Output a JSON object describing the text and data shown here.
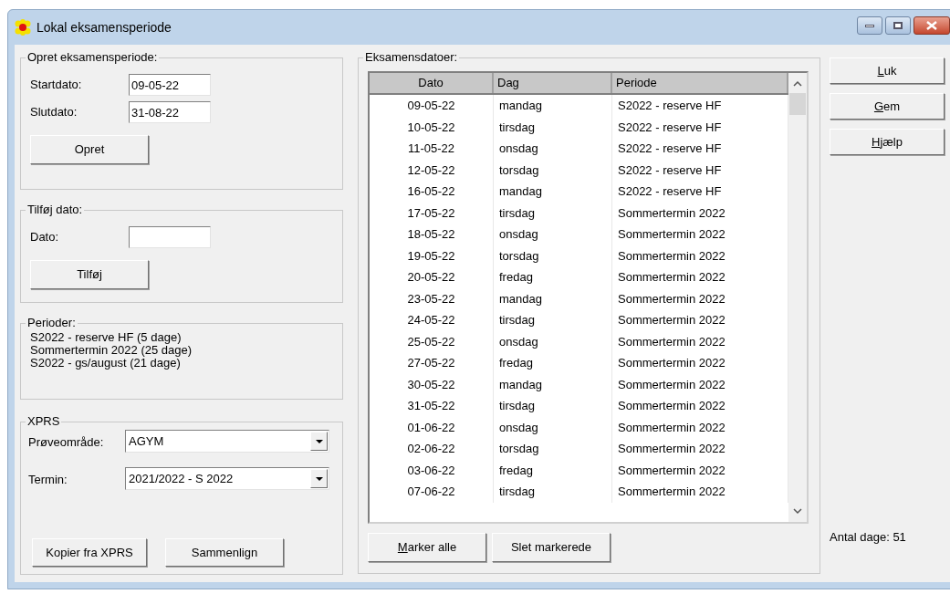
{
  "window": {
    "title": "Lokal eksamensperiode",
    "controls": [
      {
        "kind": "minimize"
      },
      {
        "kind": "maximize"
      },
      {
        "kind": "close"
      }
    ]
  },
  "opret": {
    "title": "Opret eksamensperiode:",
    "fields": [
      {
        "label": "Startdato:",
        "value": "09-05-22"
      },
      {
        "label": "Slutdato:",
        "value": "31-08-22"
      }
    ],
    "button": {
      "label": "Opret",
      "mnemonic": false
    }
  },
  "tilfoej": {
    "title": "Tilføj dato:",
    "fields": [
      {
        "label": "Dato:"
      }
    ],
    "button": {
      "label": "Tilføj",
      "mnemonic": false
    }
  },
  "perioder": {
    "title": "Perioder:",
    "lines": [
      "S2022 - reserve HF (5 dage)",
      "Sommertermin 2022 (25 dage)",
      "S2022 - gs/august (21 dage)"
    ]
  },
  "xprs": {
    "title": "XPRS",
    "combos": [
      {
        "label": "Prøveområde:",
        "value": "AGYM"
      },
      {
        "label": "Termin:",
        "value": "2021/2022 - S 2022"
      }
    ],
    "buttons": [
      {
        "label": "Kopier fra XPRS",
        "mnemonic": false
      },
      {
        "label": "Sammenlign",
        "mnemonic": false
      }
    ]
  },
  "eksamensdatoer": {
    "title": "Eksamensdatoer:",
    "table": {
      "columns": [
        "Dato",
        "Dag",
        "Periode"
      ],
      "rows": [
        [
          "09-05-22",
          "mandag",
          "S2022 - reserve HF"
        ],
        [
          "10-05-22",
          "tirsdag",
          "S2022 - reserve HF"
        ],
        [
          "11-05-22",
          "onsdag",
          "S2022 - reserve HF"
        ],
        [
          "12-05-22",
          "torsdag",
          "S2022 - reserve HF"
        ],
        [
          "16-05-22",
          "mandag",
          "S2022 - reserve HF"
        ],
        [
          "17-05-22",
          "tirsdag",
          "Sommertermin 2022"
        ],
        [
          "18-05-22",
          "onsdag",
          "Sommertermin 2022"
        ],
        [
          "19-05-22",
          "torsdag",
          "Sommertermin 2022"
        ],
        [
          "20-05-22",
          "fredag",
          "Sommertermin 2022"
        ],
        [
          "23-05-22",
          "mandag",
          "Sommertermin 2022"
        ],
        [
          "24-05-22",
          "tirsdag",
          "Sommertermin 2022"
        ],
        [
          "25-05-22",
          "onsdag",
          "Sommertermin 2022"
        ],
        [
          "27-05-22",
          "fredag",
          "Sommertermin 2022"
        ],
        [
          "30-05-22",
          "mandag",
          "Sommertermin 2022"
        ],
        [
          "31-05-22",
          "tirsdag",
          "Sommertermin 2022"
        ],
        [
          "01-06-22",
          "onsdag",
          "Sommertermin 2022"
        ],
        [
          "02-06-22",
          "torsdag",
          "Sommertermin 2022"
        ],
        [
          "03-06-22",
          "fredag",
          "Sommertermin 2022"
        ],
        [
          "07-06-22",
          "tirsdag",
          "Sommertermin 2022"
        ]
      ]
    },
    "buttons": [
      {
        "label": "Marker alle",
        "mnemonic": true
      },
      {
        "label": "Slet markerede",
        "mnemonic": false
      }
    ]
  },
  "side_buttons": [
    {
      "label": "Luk",
      "mnemonic": true
    },
    {
      "label": "Gem",
      "mnemonic": true
    },
    {
      "label": "Hjælp",
      "mnemonic": true
    }
  ],
  "antal_dage": "Antal dage: 51"
}
